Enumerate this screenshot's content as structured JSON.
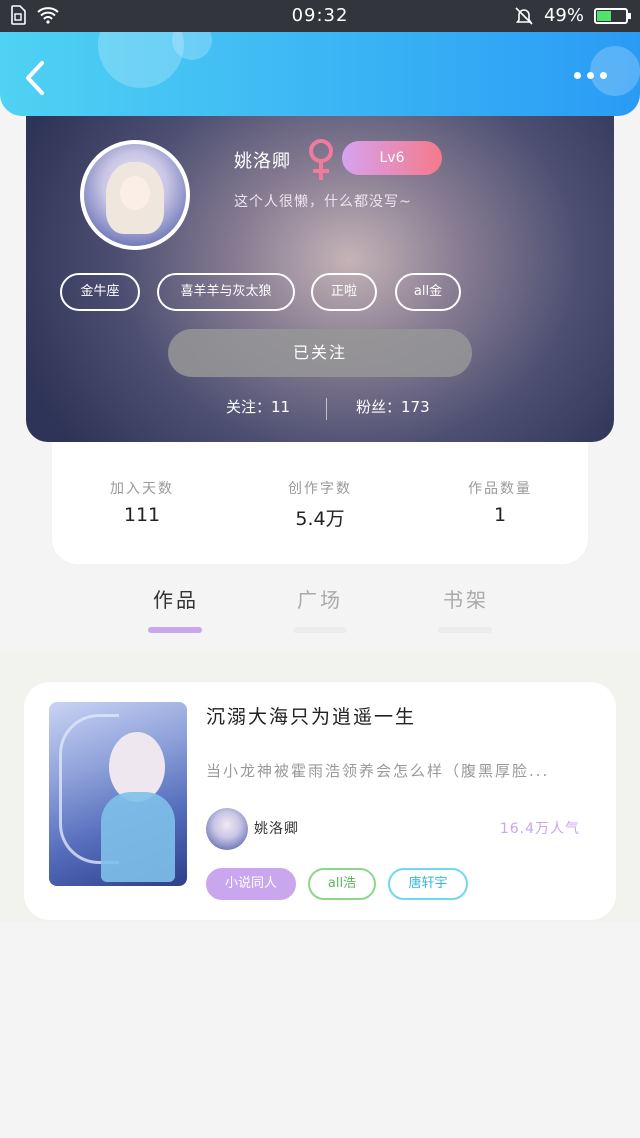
{
  "status_bar": {
    "time": "09:32",
    "battery": "49%",
    "battery_level": 0.49
  },
  "header": {
    "back_icon": "chevron-left-icon",
    "more_icon": "more-horizontal-icon"
  },
  "profile": {
    "nickname": "姚洛卿",
    "gender_symbol": "♀",
    "level": "Lv6",
    "bio": "这个人很懒，什么都没写~",
    "tags": [
      "金牛座",
      "喜羊羊与灰太狼",
      "正啦",
      "all金"
    ],
    "follow_button": "已关注",
    "following": "关注：11",
    "followers": "粉丝：173"
  },
  "stats": [
    {
      "label": "加入天数",
      "value": "111"
    },
    {
      "label": "创作字数",
      "value": "5.4万"
    },
    {
      "label": "作品数量",
      "value": "1"
    }
  ],
  "tabs": [
    {
      "label": "作品",
      "active": true
    },
    {
      "label": "广场",
      "active": false
    },
    {
      "label": "书架",
      "active": false
    }
  ],
  "work": {
    "title": "沉溺大海只为逍遥一生",
    "description": "当小龙神被霍雨浩领养会怎么样（腹黑厚脸...",
    "author": "姚洛卿",
    "popularity": "16.4万人气",
    "tags": [
      "小说同人",
      "all浩",
      "唐轩宇"
    ]
  },
  "colors": {
    "header_start": "#4fd2f3",
    "header_end": "#2a9bf5",
    "accent_purple": "#c9a6ee",
    "level_start": "#d6a2f0",
    "level_end": "#f47a8a",
    "gender_pink": "#f27a9c"
  }
}
